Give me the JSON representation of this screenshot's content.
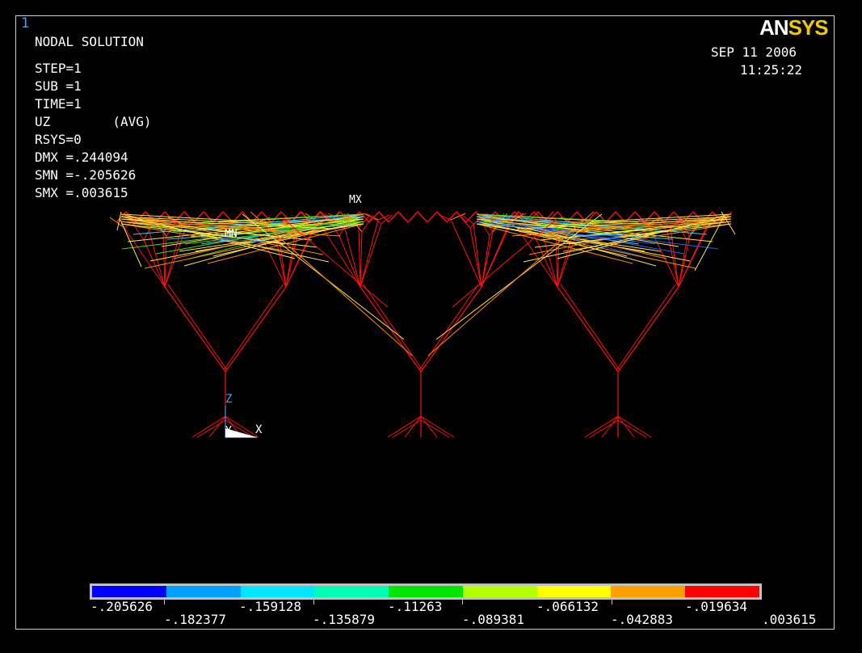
{
  "window_number": "1",
  "brand": {
    "part1": "AN",
    "part2": "SYS"
  },
  "date": "SEP 11 2006",
  "time": "11:25:22",
  "solution_title": "NODAL SOLUTION",
  "info_lines": [
    "STEP=1",
    "SUB =1",
    "TIME=1",
    "UZ        (AVG)",
    "RSYS=0",
    "DMX =.244094",
    "SMN =-.205626",
    "SMX =.003615"
  ],
  "markers": {
    "max": "MX",
    "min": "MN"
  },
  "triad": {
    "z": "Z",
    "y": "Y",
    "x": "X"
  },
  "legend": {
    "colors": [
      "#0000ff",
      "#00a0ff",
      "#00e6ff",
      "#00ffb4",
      "#00e600",
      "#b4ff00",
      "#ffff00",
      "#ffa000",
      "#ff0000"
    ],
    "upper_labels": [
      "-.205626",
      "-.159128",
      "-.11263",
      "-.066132",
      "-.019634"
    ],
    "lower_labels": [
      "-.182377",
      "-.135879",
      "-.089381",
      "-.042883",
      ".003615"
    ]
  }
}
